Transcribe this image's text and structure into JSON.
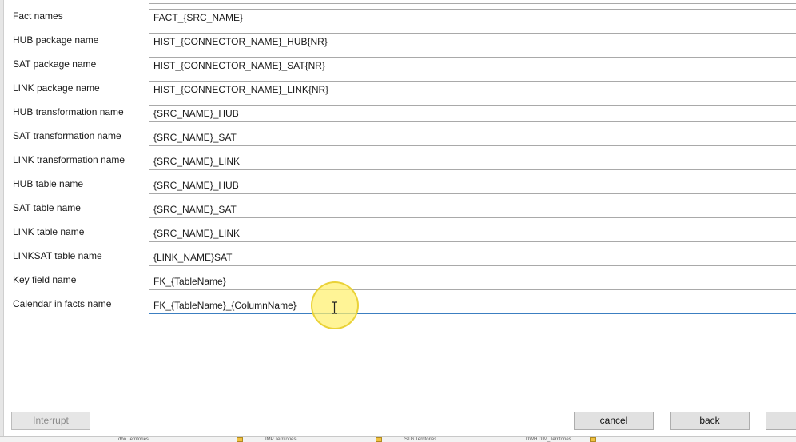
{
  "form": {
    "rows": [
      {
        "label": "Fact names",
        "value": "FACT_{SRC_NAME}"
      },
      {
        "label": "HUB package name",
        "value": "HIST_{CONNECTOR_NAME}_HUB{NR}"
      },
      {
        "label": "SAT package name",
        "value": "HIST_{CONNECTOR_NAME}_SAT{NR}"
      },
      {
        "label": "LINK package name",
        "value": "HIST_{CONNECTOR_NAME}_LINK{NR}"
      },
      {
        "label": "HUB transformation name",
        "value": "{SRC_NAME}_HUB"
      },
      {
        "label": "SAT transformation name",
        "value": "{SRC_NAME}_SAT"
      },
      {
        "label": "LINK transformation name",
        "value": "{SRC_NAME}_LINK"
      },
      {
        "label": "HUB table name",
        "value": "{SRC_NAME}_HUB"
      },
      {
        "label": "SAT table name",
        "value": "{SRC_NAME}_SAT"
      },
      {
        "label": "LINK table name",
        "value": "{SRC_NAME}_LINK"
      },
      {
        "label": "LINKSAT table name",
        "value": "{LINK_NAME}SAT"
      },
      {
        "label": "Key field name",
        "value": "FK_{TableName}"
      },
      {
        "label": "Calendar in facts name",
        "value": "FK_{TableName}_{ColumnName}"
      }
    ]
  },
  "buttons": {
    "interrupt": "Interrupt",
    "cancel": "cancel",
    "back": "back"
  },
  "taskbar": {
    "items": [
      "dbo Territories",
      "IMP Territories",
      "STG Territories",
      "DWH DIM_Territories"
    ],
    "badges": [
      "IP",
      "HP",
      "T"
    ]
  },
  "colors": {
    "active_field_border": "#3c7fc1",
    "cursor_highlight": "#fff06e"
  }
}
